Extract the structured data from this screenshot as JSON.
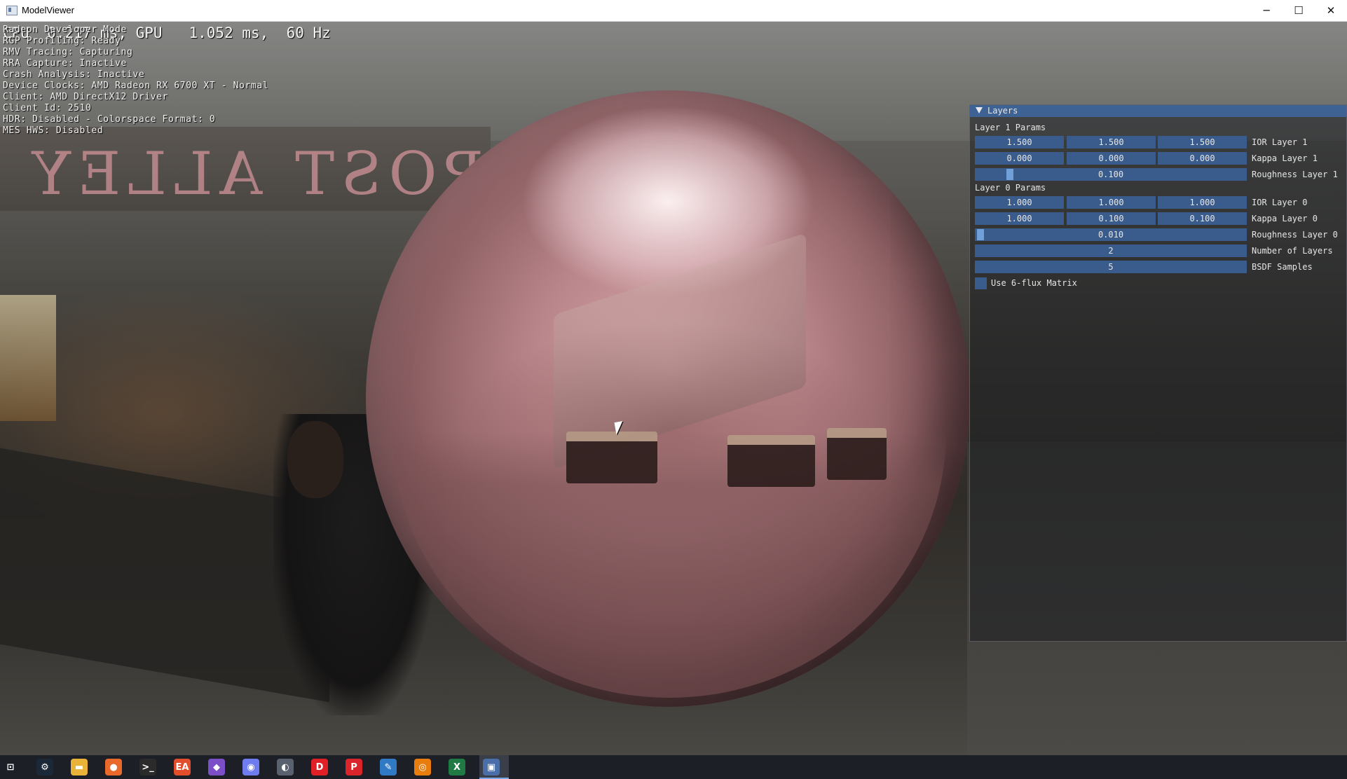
{
  "window": {
    "title": "ModelViewer",
    "minimize_glyph": "─",
    "maximize_glyph": "☐",
    "close_glyph": "✕"
  },
  "scene": {
    "sign_text": "POST ALLEY CA"
  },
  "hud": {
    "gpu_line": "CPU  0.217 ms, GPU   1.052 ms,  60 Hz",
    "lines": [
      "Radeon Developer Mode",
      "RGP Profiling: Ready",
      "RMV Tracing: Capturing",
      "RRA Capture: Inactive",
      "Crash Analysis: Inactive",
      "Device Clocks: AMD Radeon RX 6700 XT - Normal",
      "Client: AMD DirectX12 Driver",
      "Client Id: 2510",
      "HDR: Disabled - Colorspace Format: 0",
      "MES HWS: Disabled"
    ]
  },
  "panel": {
    "title": "Layers",
    "layer1_label": "Layer 1 Params",
    "layer0_label": "Layer 0 Params",
    "ior1": [
      "1.500",
      "1.500",
      "1.500"
    ],
    "ior1_label": "IOR Layer 1",
    "kappa1": [
      "0.000",
      "0.000",
      "0.000"
    ],
    "kappa1_label": "Kappa Layer 1",
    "rough1": "0.100",
    "rough1_label": "Roughness Layer 1",
    "ior0": [
      "1.000",
      "1.000",
      "1.000"
    ],
    "ior0_label": "IOR Layer 0",
    "kappa0": [
      "1.000",
      "0.100",
      "0.100"
    ],
    "kappa0_label": "Kappa Layer 0",
    "rough0": "0.010",
    "rough0_label": "Roughness Layer 0",
    "num_layers": "2",
    "num_layers_label": "Number of Layers",
    "bsdf_samples": "5",
    "bsdf_samples_label": "BSDF Samples",
    "six_flux_label": "Use 6-flux Matrix",
    "six_flux_checked": false
  },
  "colors": {
    "panel_header": "#3e6294",
    "field_bg": "#3a5c8c",
    "slider_grab": "#6fa0d8"
  },
  "taskbar": {
    "icons": [
      {
        "name": "task-view-icon",
        "glyph": "⊡",
        "color": "#1c1f26"
      },
      {
        "name": "steam-icon",
        "glyph": "⚙",
        "color": "#1b2838"
      },
      {
        "name": "file-explorer-icon",
        "glyph": "▬",
        "color": "#e9b33a"
      },
      {
        "name": "firefox-icon",
        "glyph": "●",
        "color": "#e8692a"
      },
      {
        "name": "terminal-icon",
        "glyph": ">_",
        "color": "#2b2b2b"
      },
      {
        "name": "ea-app-icon",
        "glyph": "EA",
        "color": "#e24d2c"
      },
      {
        "name": "visual-studio-icon",
        "glyph": "◆",
        "color": "#7a4fc8"
      },
      {
        "name": "discord-icon",
        "glyph": "◉",
        "color": "#6f7cf0"
      },
      {
        "name": "radeon-tool-icon",
        "glyph": "◐",
        "color": "#59616e"
      },
      {
        "name": "d-app-icon",
        "glyph": "D",
        "color": "#e11f26"
      },
      {
        "name": "p-app-icon",
        "glyph": "P",
        "color": "#d9242b"
      },
      {
        "name": "paint-icon",
        "glyph": "✎",
        "color": "#2f79c5"
      },
      {
        "name": "blender-icon",
        "glyph": "◎",
        "color": "#e87d0d"
      },
      {
        "name": "excel-icon",
        "glyph": "X",
        "color": "#1f7a43"
      },
      {
        "name": "modelviewer-icon",
        "glyph": "▣",
        "color": "#4a6fa8"
      }
    ]
  }
}
